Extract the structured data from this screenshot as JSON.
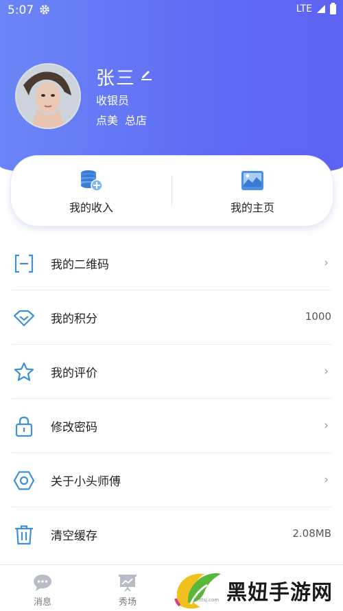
{
  "status_bar": {
    "time": "5:07",
    "network": "LTE"
  },
  "profile": {
    "name": "张三",
    "role": "收银员",
    "brand": "点美",
    "store": "总店"
  },
  "card": {
    "items": [
      {
        "label": "我的收入",
        "icon": "income-coins-icon"
      },
      {
        "label": "我的主页",
        "icon": "homepage-image-icon"
      }
    ]
  },
  "menu": {
    "items": [
      {
        "label": "我的二维码",
        "icon": "qr-scan-icon",
        "value": "",
        "chevron": "›"
      },
      {
        "label": "我的积分",
        "icon": "diamond-icon",
        "value": "1000",
        "chevron": ""
      },
      {
        "label": "我的评价",
        "icon": "star-icon",
        "value": "",
        "chevron": "›"
      },
      {
        "label": "修改密码",
        "icon": "lock-icon",
        "value": "",
        "chevron": "›"
      },
      {
        "label": "关于小头师傅",
        "icon": "hexagon-icon",
        "value": "",
        "chevron": "›"
      },
      {
        "label": "清空缓存",
        "icon": "trash-icon",
        "value": "2.08MB",
        "chevron": ""
      }
    ]
  },
  "tabbar": {
    "items": [
      {
        "label": "消息",
        "icon": "chat-bubble-icon"
      },
      {
        "label": "秀场",
        "icon": "presentation-icon"
      }
    ]
  },
  "watermark": {
    "text": "黑妞手游网",
    "url": "hnttsj.com"
  },
  "colors": {
    "header_start": "#6b86f6",
    "header_end": "#5d63f2",
    "icon_blue": "#3d8fd9",
    "card_icon": "#4a90e2"
  }
}
